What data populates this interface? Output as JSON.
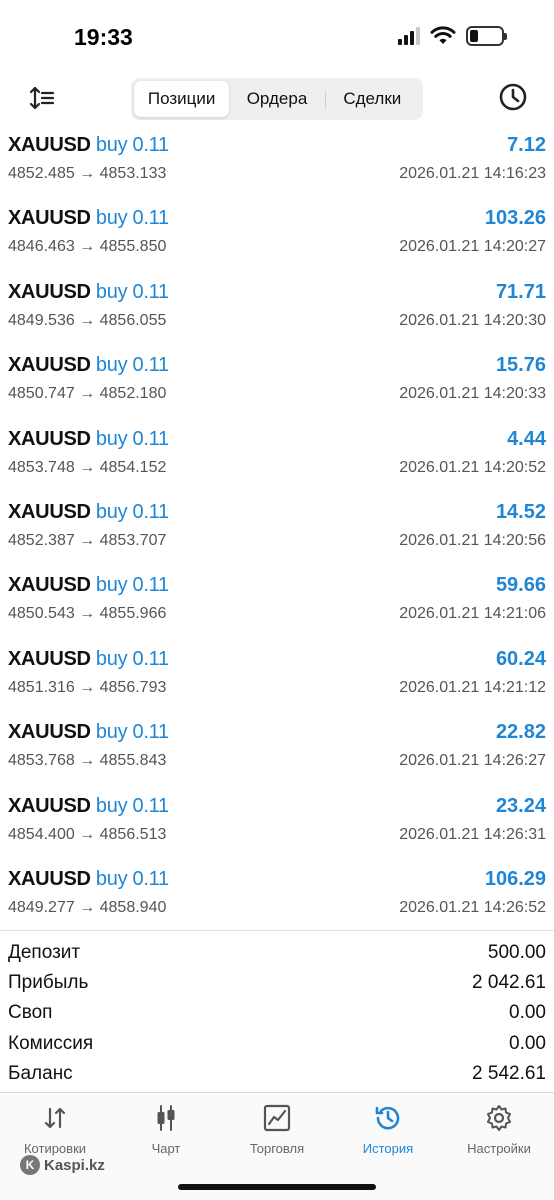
{
  "status": {
    "time": "19:33"
  },
  "toolbar": {
    "sort_icon": "sort-icon",
    "history_icon": "clock-icon",
    "segments": [
      "Позиции",
      "Ордера",
      "Сделки"
    ],
    "active_segment": "Позиции"
  },
  "deals": [
    {
      "symbol": "XAUUSD",
      "direction": "buy 0.11",
      "profit": "7.12",
      "prices": "4852.485 → 4853.133",
      "time": "2026.01.21 14:16:23"
    },
    {
      "symbol": "XAUUSD",
      "direction": "buy 0.11",
      "profit": "103.26",
      "prices": "4846.463 → 4855.850",
      "time": "2026.01.21 14:20:27"
    },
    {
      "symbol": "XAUUSD",
      "direction": "buy 0.11",
      "profit": "71.71",
      "prices": "4849.536 → 4856.055",
      "time": "2026.01.21 14:20:30"
    },
    {
      "symbol": "XAUUSD",
      "direction": "buy 0.11",
      "profit": "15.76",
      "prices": "4850.747 → 4852.180",
      "time": "2026.01.21 14:20:33"
    },
    {
      "symbol": "XAUUSD",
      "direction": "buy 0.11",
      "profit": "4.44",
      "prices": "4853.748 → 4854.152",
      "time": "2026.01.21 14:20:52"
    },
    {
      "symbol": "XAUUSD",
      "direction": "buy 0.11",
      "profit": "14.52",
      "prices": "4852.387 → 4853.707",
      "time": "2026.01.21 14:20:56"
    },
    {
      "symbol": "XAUUSD",
      "direction": "buy 0.11",
      "profit": "59.66",
      "prices": "4850.543 → 4855.966",
      "time": "2026.01.21 14:21:06"
    },
    {
      "symbol": "XAUUSD",
      "direction": "buy 0.11",
      "profit": "60.24",
      "prices": "4851.316 → 4856.793",
      "time": "2026.01.21 14:21:12"
    },
    {
      "symbol": "XAUUSD",
      "direction": "buy 0.11",
      "profit": "22.82",
      "prices": "4853.768 → 4855.843",
      "time": "2026.01.21 14:26:27"
    },
    {
      "symbol": "XAUUSD",
      "direction": "buy 0.11",
      "profit": "23.24",
      "prices": "4854.400 → 4856.513",
      "time": "2026.01.21 14:26:31"
    },
    {
      "symbol": "XAUUSD",
      "direction": "buy 0.11",
      "profit": "106.29",
      "prices": "4849.277 → 4858.940",
      "time": "2026.01.21 14:26:52"
    }
  ],
  "summary": [
    {
      "label": "Депозит",
      "value": "500.00"
    },
    {
      "label": "Прибыль",
      "value": "2 042.61"
    },
    {
      "label": "Своп",
      "value": "0.00"
    },
    {
      "label": "Комиссия",
      "value": "0.00"
    },
    {
      "label": "Баланс",
      "value": "2 542.61"
    }
  ],
  "tabbar": [
    {
      "label": "Котировки",
      "icon": "quotes-icon"
    },
    {
      "label": "Чарт",
      "icon": "chart-icon"
    },
    {
      "label": "Торговля",
      "icon": "trade-icon"
    },
    {
      "label": "История",
      "icon": "history-icon",
      "active": true
    },
    {
      "label": "Настройки",
      "icon": "settings-icon"
    }
  ],
  "watermark": "Kaspi.kz",
  "colors": {
    "accent": "#1f86d6",
    "text": "#111111",
    "secondary": "#555555"
  }
}
